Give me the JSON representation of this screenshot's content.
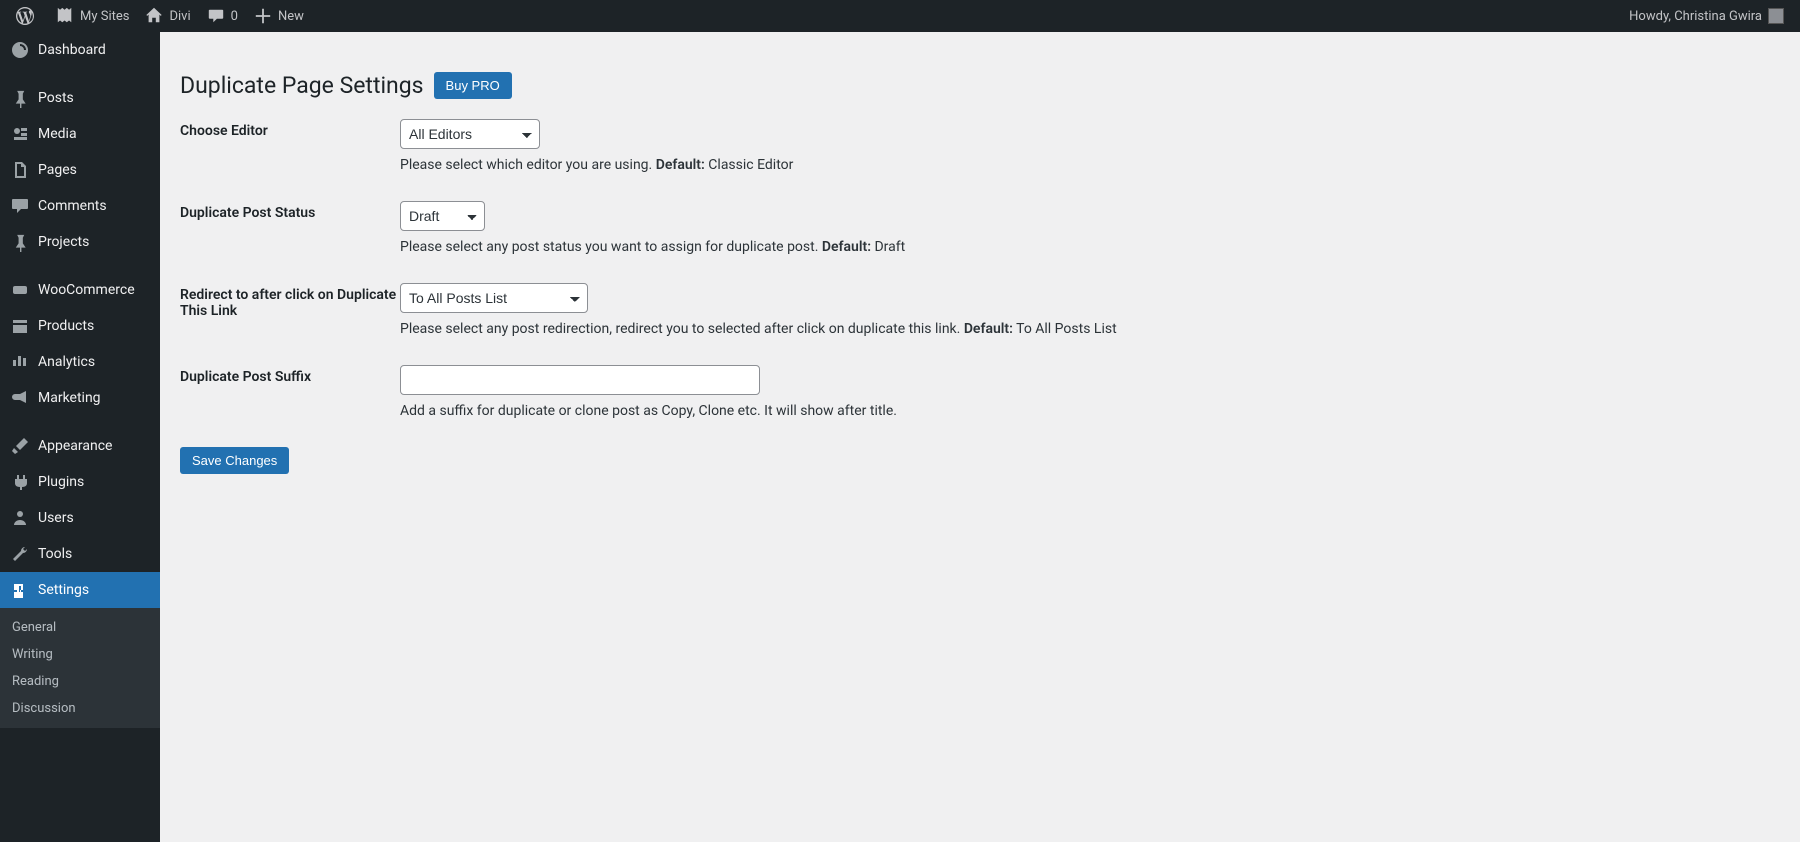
{
  "adminbar": {
    "my_sites": "My Sites",
    "site_name": "Divi",
    "comments_count": "0",
    "new_label": "New",
    "howdy": "Howdy, Christina Gwira"
  },
  "sidebar": {
    "items": [
      {
        "label": "Dashboard"
      },
      {
        "label": "Posts"
      },
      {
        "label": "Media"
      },
      {
        "label": "Pages"
      },
      {
        "label": "Comments"
      },
      {
        "label": "Projects"
      },
      {
        "label": "WooCommerce"
      },
      {
        "label": "Products"
      },
      {
        "label": "Analytics"
      },
      {
        "label": "Marketing"
      },
      {
        "label": "Appearance"
      },
      {
        "label": "Plugins"
      },
      {
        "label": "Users"
      },
      {
        "label": "Tools"
      },
      {
        "label": "Settings"
      }
    ],
    "submenu": [
      {
        "label": "General"
      },
      {
        "label": "Writing"
      },
      {
        "label": "Reading"
      },
      {
        "label": "Discussion"
      }
    ]
  },
  "page": {
    "title": "Duplicate Page Settings",
    "buy_pro": "Buy PRO",
    "save_changes": "Save Changes"
  },
  "fields": {
    "editor": {
      "label": "Choose Editor",
      "value": "All Editors",
      "desc_pre": "Please select which editor you are using. ",
      "desc_strong": "Default:",
      "desc_post": " Classic Editor"
    },
    "status": {
      "label": "Duplicate Post Status",
      "value": "Draft",
      "desc_pre": "Please select any post status you want to assign for duplicate post. ",
      "desc_strong": "Default:",
      "desc_post": " Draft"
    },
    "redirect": {
      "label": "Redirect to after click on Duplicate This Link",
      "value": "To All Posts List",
      "desc_pre": "Please select any post redirection, redirect you to selected after click on duplicate this link. ",
      "desc_strong": "Default:",
      "desc_post": " To All Posts List"
    },
    "suffix": {
      "label": "Duplicate Post Suffix",
      "value": "",
      "desc": "Add a suffix for duplicate or clone post as Copy, Clone etc. It will show after title."
    }
  }
}
